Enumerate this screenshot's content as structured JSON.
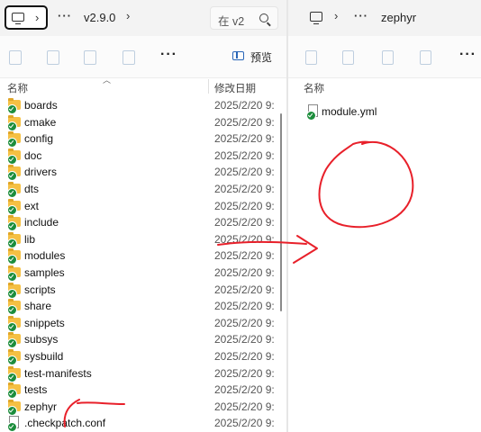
{
  "left_pane": {
    "address": {
      "path": [
        "v2.9.0"
      ],
      "search_placeholder": "在 v2"
    },
    "toolbar": {
      "preview_label": "预览",
      "more_label": "···"
    },
    "columns": {
      "name": "名称",
      "modified": "修改日期"
    },
    "rows": [
      {
        "name": "boards",
        "date": "2025/2/20 9:",
        "type": "folder"
      },
      {
        "name": "cmake",
        "date": "2025/2/20 9:",
        "type": "folder"
      },
      {
        "name": "config",
        "date": "2025/2/20 9:",
        "type": "folder"
      },
      {
        "name": "doc",
        "date": "2025/2/20 9:",
        "type": "folder"
      },
      {
        "name": "drivers",
        "date": "2025/2/20 9:",
        "type": "folder"
      },
      {
        "name": "dts",
        "date": "2025/2/20 9:",
        "type": "folder"
      },
      {
        "name": "ext",
        "date": "2025/2/20 9:",
        "type": "folder"
      },
      {
        "name": "include",
        "date": "2025/2/20 9:",
        "type": "folder"
      },
      {
        "name": "lib",
        "date": "2025/2/20 9:",
        "type": "folder"
      },
      {
        "name": "modules",
        "date": "2025/2/20 9:",
        "type": "folder"
      },
      {
        "name": "samples",
        "date": "2025/2/20 9:",
        "type": "folder"
      },
      {
        "name": "scripts",
        "date": "2025/2/20 9:",
        "type": "folder"
      },
      {
        "name": "share",
        "date": "2025/2/20 9:",
        "type": "folder"
      },
      {
        "name": "snippets",
        "date": "2025/2/20 9:",
        "type": "folder"
      },
      {
        "name": "subsys",
        "date": "2025/2/20 9:",
        "type": "folder"
      },
      {
        "name": "sysbuild",
        "date": "2025/2/20 9:",
        "type": "folder"
      },
      {
        "name": "test-manifests",
        "date": "2025/2/20 9:",
        "type": "folder"
      },
      {
        "name": "tests",
        "date": "2025/2/20 9:",
        "type": "folder"
      },
      {
        "name": "zephyr",
        "date": "2025/2/20 9:",
        "type": "folder"
      },
      {
        "name": ".checkpatch.conf",
        "date": "2025/2/20 9:",
        "type": "file"
      }
    ]
  },
  "right_pane": {
    "address": {
      "path": [
        "zephyr"
      ]
    },
    "toolbar": {
      "more_label": "···"
    },
    "columns": {
      "name": "名称"
    },
    "rows": [
      {
        "name": "module.yml",
        "type": "file"
      }
    ]
  },
  "colors": {
    "folder": "#f5c043",
    "sync_check": "#1c8d3c",
    "annotation_red": "#e8202a",
    "accent": "#2866b8"
  }
}
